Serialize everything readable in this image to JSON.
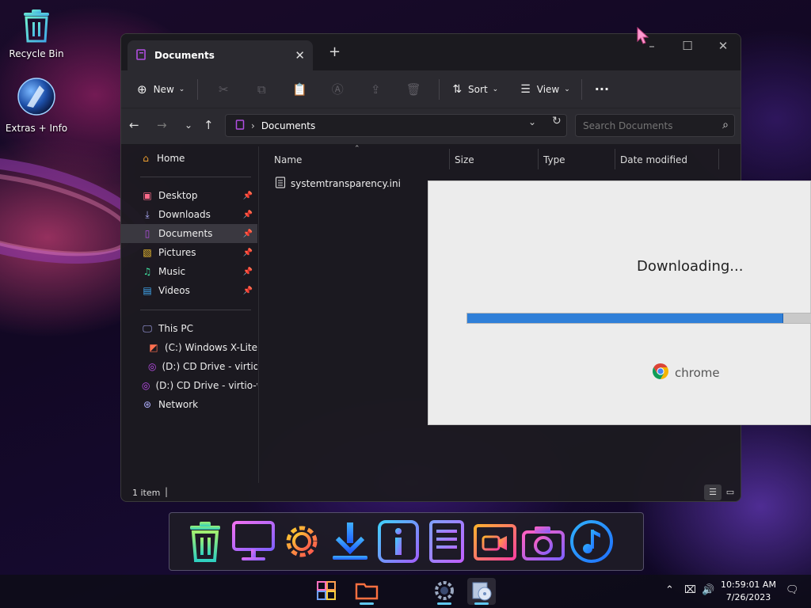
{
  "desktop": {
    "icons": [
      {
        "label": "Recycle Bin"
      },
      {
        "label": "Extras + Info"
      }
    ]
  },
  "explorer": {
    "tab_title": "Documents",
    "toolbar": {
      "new_label": "New",
      "sort_label": "Sort",
      "view_label": "View"
    },
    "address": {
      "crumb": "Documents",
      "search_placeholder": "Search Documents"
    },
    "nav": {
      "home": "Home",
      "quick_access": [
        {
          "label": "Desktop",
          "icon": "desktop-icon"
        },
        {
          "label": "Downloads",
          "icon": "download-icon"
        },
        {
          "label": "Documents",
          "icon": "documents-icon"
        },
        {
          "label": "Pictures",
          "icon": "pictures-icon"
        },
        {
          "label": "Music",
          "icon": "music-icon"
        },
        {
          "label": "Videos",
          "icon": "videos-icon"
        }
      ],
      "this_pc": "This PC",
      "drives": [
        {
          "label": "(C:) Windows X-Lite"
        },
        {
          "label": "(D:) CD Drive - virtio"
        },
        {
          "label": "(D:) CD Drive - virtio-w"
        }
      ],
      "network": "Network"
    },
    "columns": {
      "name": "Name",
      "size": "Size",
      "type": "Type",
      "date_modified": "Date modified"
    },
    "files": [
      {
        "name": "systemtransparency.ini"
      }
    ],
    "status": "1 item"
  },
  "chrome_popup": {
    "message": "Downloading...",
    "progress": 0.92,
    "brand": "chrome"
  },
  "dock": {
    "icons": [
      "trash-icon",
      "monitor-icon",
      "settings-gear-icon",
      "download-icon",
      "info-icon",
      "document-list-icon",
      "video-camera-icon",
      "camera-icon",
      "music-note-icon"
    ]
  },
  "taskbar": {
    "time": "10:59:01 AM",
    "date": "7/26/2023"
  },
  "colors": {
    "accent": "#60c8f0",
    "progress_fill": "#2f7fd8"
  }
}
